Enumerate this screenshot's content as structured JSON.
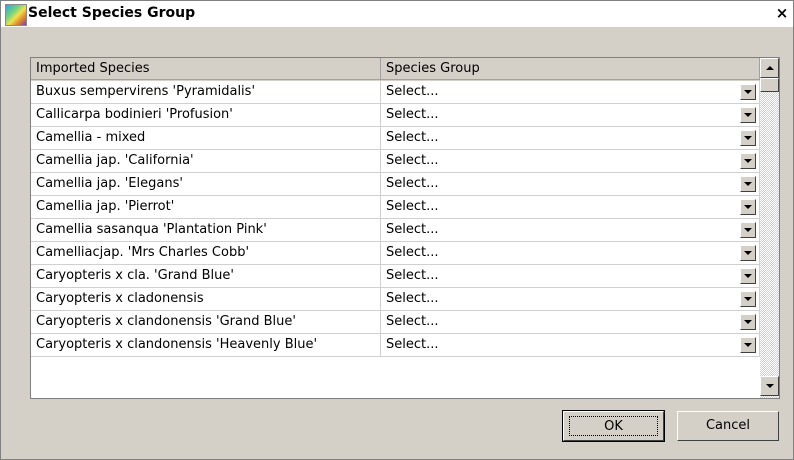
{
  "window": {
    "title": "Select Species Group",
    "close_label": "×"
  },
  "table": {
    "columns": [
      "Imported Species",
      "Species Group"
    ],
    "rows": [
      {
        "species": "Buxus sempervirens 'Pyramidalis'",
        "group": "Select..."
      },
      {
        "species": "Callicarpa bodinieri 'Profusion'",
        "group": "Select..."
      },
      {
        "species": "Camellia - mixed",
        "group": "Select..."
      },
      {
        "species": "Camellia jap. 'California'",
        "group": "Select..."
      },
      {
        "species": "Camellia jap. 'Elegans'",
        "group": "Select..."
      },
      {
        "species": "Camellia jap. 'Pierrot'",
        "group": "Select..."
      },
      {
        "species": "Camellia sasanqua 'Plantation Pink'",
        "group": "Select..."
      },
      {
        "species": "Camelliacjap. 'Mrs Charles Cobb'",
        "group": "Select..."
      },
      {
        "species": "Caryopteris x cla. 'Grand Blue'",
        "group": "Select..."
      },
      {
        "species": "Caryopteris x cladonensis",
        "group": "Select..."
      },
      {
        "species": "Caryopteris x clandonensis 'Grand Blue'",
        "group": "Select..."
      },
      {
        "species": "Caryopteris x clandonensis 'Heavenly Blue'",
        "group": "Select..."
      }
    ]
  },
  "buttons": {
    "ok": "OK",
    "cancel": "Cancel"
  },
  "icons": {
    "app": "app-logo-icon",
    "close": "close-icon",
    "dropdown": "chevron-down-icon"
  },
  "colors": {
    "dialog_bg": "#d4d0c8",
    "title_bg": "#ffffff"
  }
}
